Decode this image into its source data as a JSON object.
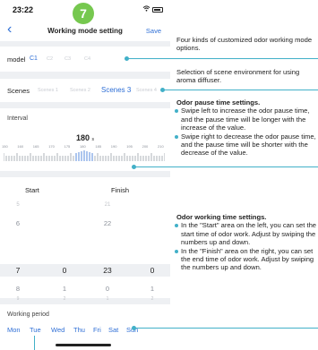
{
  "status_bar": {
    "time": "23:22",
    "wifi_icon": "wifi-icon",
    "battery_icon": "battery-icon"
  },
  "step_badge": "7",
  "navbar": {
    "back_icon": "chevron-left-icon",
    "title": "Working mode setting",
    "save_label": "Save"
  },
  "model": {
    "label": "model",
    "options": [
      "C1",
      "C2",
      "C3",
      "C4"
    ],
    "selected": "C1"
  },
  "scenes": {
    "label": "Scenes",
    "options": [
      "Scenes 1",
      "Scenes 2",
      "Scenes 3",
      "Scenes 4"
    ],
    "selected": "Scenes 3"
  },
  "interval": {
    "label": "Interval",
    "value": "180",
    "unit": "s",
    "ruler_labels": [
      "150",
      "160",
      "165",
      "170",
      "175",
      "180",
      "185",
      "190",
      "195",
      "200",
      "210"
    ],
    "ruler_min": 150,
    "ruler_max": 210,
    "current": 180
  },
  "working_time": {
    "start_label": "Start",
    "finish_label": "Finish",
    "start_hours": [
      "5",
      "6",
      "7",
      "8",
      "9"
    ],
    "start_minutes": [
      "",
      "",
      "0",
      "1",
      "2"
    ],
    "finish_hours": [
      "21",
      "22",
      "23",
      "0",
      "1"
    ],
    "finish_minutes": [
      "",
      "",
      "0",
      "1",
      "2"
    ]
  },
  "working_period": {
    "label": "Working period",
    "days": [
      "Mon",
      "Tue",
      "Wed",
      "Thu",
      "Fri",
      "Sat",
      "Sun"
    ]
  },
  "annotations": {
    "model": "Four kinds of customized odor working mode options.",
    "scenes": "Selection of scene environment for using aroma diffuser.",
    "interval_title": "Odor pause time settings.",
    "interval_b1": "Swipe left to increase the odor pause time, and the pause time will be longer with the increase of the value.",
    "interval_b2": "Swipe right to decrease the odor pause time, and the pause time will be shorter with the decrease of the value.",
    "time_title": "Odor working time settings.",
    "time_b1": "In the \"Start\" area on the left, you can set the start time of odor work. Adjust by swiping the numbers up and down.",
    "time_b2": "In the \"Finish\" area on the right, you can set the end time of odor work. Adjust by swiping the numbers up and down."
  },
  "colors": {
    "accent": "#2f6fd6",
    "badge": "#76c84f",
    "annotation_line": "#42b0c8"
  }
}
